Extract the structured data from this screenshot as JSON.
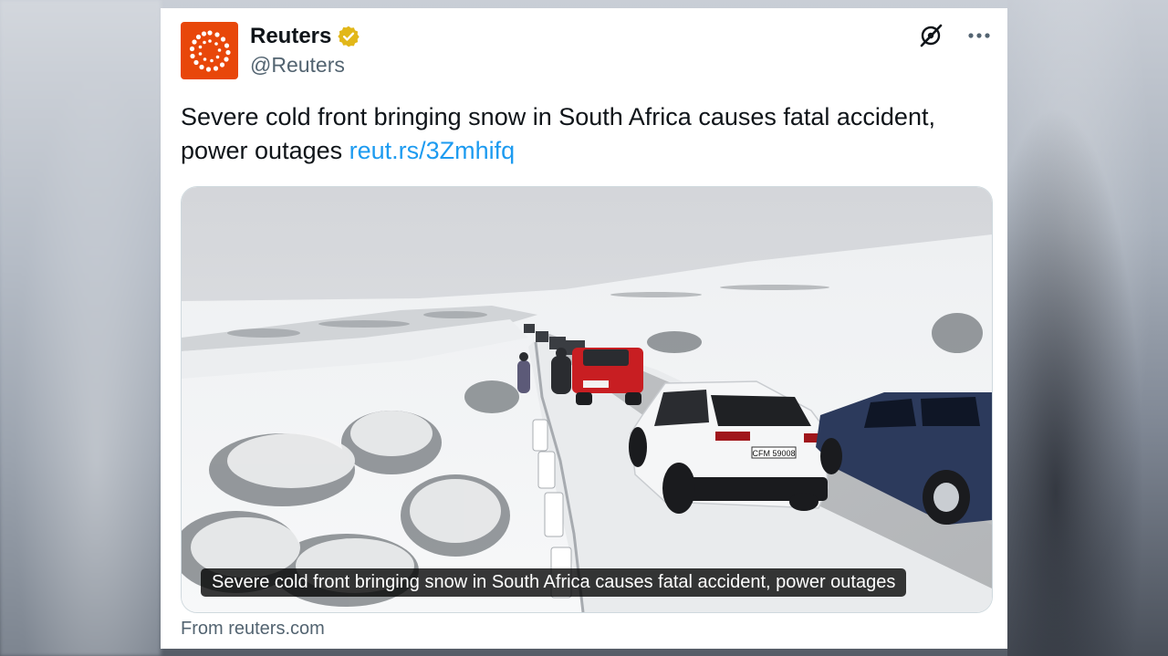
{
  "post": {
    "author_name": "Reuters",
    "author_handle": "@Reuters",
    "verified_badge_icon": "verified-badge-icon",
    "text_main": "Severe cold front bringing snow in South Africa causes fatal accident, power outages ",
    "link_text": "reut.rs/3Zmhifq",
    "media_caption": "Severe cold front bringing snow in South Africa causes fatal accident, power outages",
    "source_text": "From reuters.com"
  },
  "photo": {
    "license_plate": "CFM 59008"
  },
  "icons": {
    "grok": "grok-icon",
    "more": "more-options-icon",
    "logo": "reuters-logo-icon"
  },
  "colors": {
    "brand": "#e8470a",
    "link": "#1d9bf0",
    "verified": "#e2b719",
    "text": "#0f1419",
    "secondary": "#536471"
  }
}
